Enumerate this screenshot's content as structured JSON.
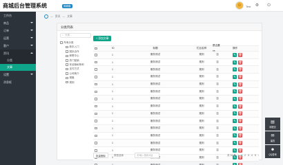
{
  "app": {
    "title": "商城后台管理系统",
    "version": "商城版",
    "username": "Test"
  },
  "sidebar": {
    "items": [
      {
        "label": "工作台",
        "expandable": false
      },
      {
        "label": "商品",
        "expandable": true
      },
      {
        "label": "订单",
        "expandable": true
      },
      {
        "label": "运营",
        "expandable": true
      },
      {
        "label": "客户",
        "expandable": true
      },
      {
        "label": "资讯",
        "expandable": true,
        "open": true
      },
      {
        "label": "设置",
        "expandable": true
      },
      {
        "label": "消息框",
        "expandable": false
      }
    ],
    "subitems": [
      "分类",
      "文章"
    ],
    "active_sub": "文章"
  },
  "breadcrumb": {
    "items": [
      "资讯",
      "文章"
    ]
  },
  "panel": {
    "title": "分类列表"
  },
  "tree": {
    "search_placeholder": "分类...",
    "root": "所有分类",
    "children": [
      "新手入门",
      "团队合作",
      "邮寄中心",
      "热门促销",
      "安全隐私条例",
      "支付方式",
      "公司简介",
      "规格",
      "规则"
    ]
  },
  "toolbar": {
    "add_label": "+ 添加文章"
  },
  "table": {
    "headers": {
      "id": "ID",
      "title": "标题",
      "category": "栏目名称",
      "top": "是否置顶",
      "ops": "操作"
    },
    "rows": [
      {
        "id": "1",
        "title": "服务测试",
        "category": "规则",
        "top": "否"
      },
      {
        "id": "1",
        "title": "服务测试",
        "category": "规则",
        "top": "否"
      },
      {
        "id": "1",
        "title": "服务测试",
        "category": "规则",
        "top": "否"
      },
      {
        "id": "1",
        "title": "服务测试",
        "category": "规则",
        "top": "否"
      },
      {
        "id": "1",
        "title": "服务测试",
        "category": "规则",
        "top": "否"
      },
      {
        "id": "1",
        "title": "服务测试",
        "category": "规则",
        "top": "否"
      },
      {
        "id": "1",
        "title": "服务测试",
        "category": "规则",
        "top": "否"
      },
      {
        "id": "1",
        "title": "服务测试",
        "category": "规则",
        "top": "否"
      },
      {
        "id": "1",
        "title": "服务测试",
        "category": "规则",
        "top": "否"
      },
      {
        "id": "1",
        "title": "服务测试",
        "category": "规则",
        "top": "否"
      },
      {
        "id": "1",
        "title": "服务测试",
        "category": "规则",
        "top": "否"
      },
      {
        "id": "1",
        "title": "服务测试",
        "category": "规则",
        "top": "否"
      },
      {
        "id": "1",
        "title": "服务测试",
        "category": "规则",
        "top": "否"
      },
      {
        "id": "1",
        "title": "服务测试",
        "category": "规则",
        "top": "否"
      },
      {
        "id": "1",
        "title": "服务测试",
        "category": "规则",
        "top": "否"
      },
      {
        "id": "1",
        "title": "服务测试",
        "category": "规则",
        "top": "否"
      }
    ]
  },
  "footer": {
    "batch_delete": "批量删除",
    "select_all": "类型选择",
    "search_placeholder": "关/输入搜索对话",
    "total": "共 32 条",
    "pages": [
      "1",
      "2",
      "3",
      "4",
      "5"
    ],
    "prev": "‹",
    "next": "›"
  },
  "float_tools": [
    {
      "label": "待提交",
      "icon": "clipboard-icon"
    },
    {
      "label": "留言",
      "icon": "chat-icon"
    },
    {
      "label": "QQ咨询",
      "icon": "qq-icon"
    }
  ],
  "colors": {
    "accent": "#0fa58a",
    "danger": "#e04a4a",
    "sidebar_bg": "#2d333b",
    "brand_badge": "#1e88c7"
  }
}
